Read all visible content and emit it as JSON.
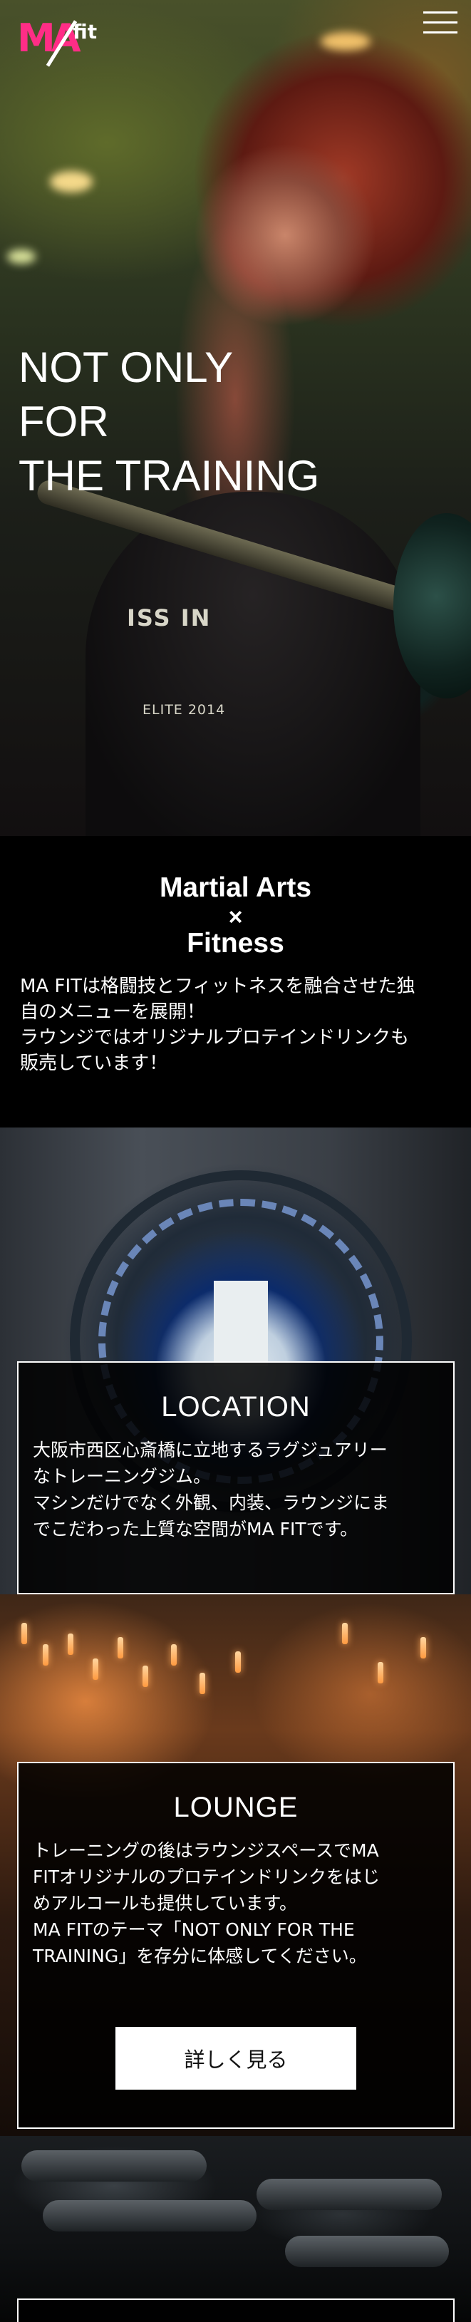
{
  "header": {
    "logo": {
      "main": "MA",
      "sub": "fit"
    },
    "menu_icon": "hamburger-icon"
  },
  "hero": {
    "title_lines": [
      "NOT ONLY",
      "FOR",
      "THE TRAINING"
    ],
    "shirt_print_1": "ISS IN",
    "shirt_print_2": "ELITE 2014"
  },
  "intro": {
    "heading_line1": "Martial Arts",
    "heading_line2": "×",
    "heading_line3": "Fitness",
    "text_lines": [
      "MA FITは格闘技とフィットネスを融合させた独",
      "自のメニューを展開！",
      "ラウンジではオリジナルプロテインドリンクも",
      "販売しています！"
    ]
  },
  "location": {
    "title": "LOCATION",
    "text_lines": [
      "大阪市西区心斎橋に立地するラグジュアリー",
      "なトレーニングジム。",
      "マシンだけでなく外観、内装、ラウンジにま",
      "でこだわった上質な空間がMA FITです。"
    ]
  },
  "lounge": {
    "title": "LOUNGE",
    "text_lines": [
      "トレーニングの後はラウンジスペースでMA",
      "FITオリジナルのプロテインドリンクをはじ",
      "めアルコールも提供しています。",
      "MA FITのテーマ「NOT ONLY FOR THE",
      "TRAINING」を存分に体感してください。"
    ],
    "button_label": "詳しく見る"
  },
  "colors": {
    "brand_pink": "#ff2d86",
    "background": "#000000",
    "text": "#ffffff",
    "button_bg": "#ffffff"
  }
}
